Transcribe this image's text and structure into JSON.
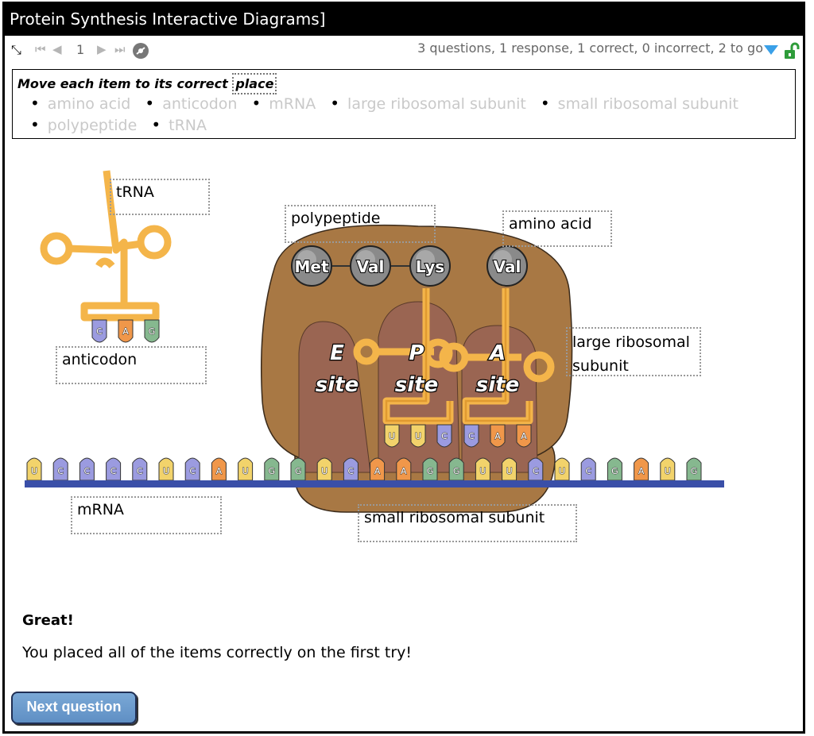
{
  "title": "Protein Synthesis Interactive Diagrams]",
  "toolbar": {
    "page_number": "1",
    "status": "3 questions, 1 response, 1 correct, 0 incorrect, 2 to go",
    "icons": [
      "expand-icon",
      "first-icon",
      "prev-icon",
      "next-icon",
      "last-icon",
      "disc-icon",
      "dropdown-icon",
      "unlock-icon"
    ]
  },
  "instruction": {
    "prefix": "Move each item to its correct",
    "place": "place"
  },
  "pool_items": [
    "amino acid",
    "anticodon",
    "mRNA",
    "large ribosomal subunit",
    "small ribosomal subunit",
    "polypeptide",
    "tRNA"
  ],
  "labels": {
    "trna": "tRNA",
    "polypeptide": "polypeptide",
    "amino_acid": "amino acid",
    "large_line1": "large ribosomal",
    "large_line2": "subunit",
    "anticodon": "anticodon",
    "mrna": "mRNA",
    "small": "small ribosomal subunit"
  },
  "diagram": {
    "amino_acids": [
      "Met",
      "Val",
      "Lys",
      "Val"
    ],
    "sites": {
      "e_letter": "E",
      "p_letter": "P",
      "a_letter": "A",
      "word": "site"
    },
    "anticodon_bases": [
      "C",
      "A",
      "G"
    ],
    "mrna_bases": [
      "U",
      "C",
      "C",
      "C",
      "C",
      "U",
      "C",
      "A",
      "U",
      "G",
      "G",
      "U",
      "C",
      "A",
      "A",
      "G",
      "G",
      "U",
      "U",
      "C",
      "U",
      "C",
      "G",
      "A",
      "U",
      "G"
    ],
    "trna_bases_p": [
      "U",
      "U",
      "C"
    ],
    "trna_bases_a": [
      "C",
      "A",
      "A"
    ],
    "colors": {
      "U": "#f2d36b",
      "C": "#9b9be0",
      "A": "#f0974a",
      "G": "#86b88f",
      "accent": "#f4b54a",
      "ribosome": "#a87844"
    }
  },
  "feedback": {
    "heading": "Great!",
    "text": "You placed all of the items correctly on the first try!"
  },
  "next_button": "Next question"
}
